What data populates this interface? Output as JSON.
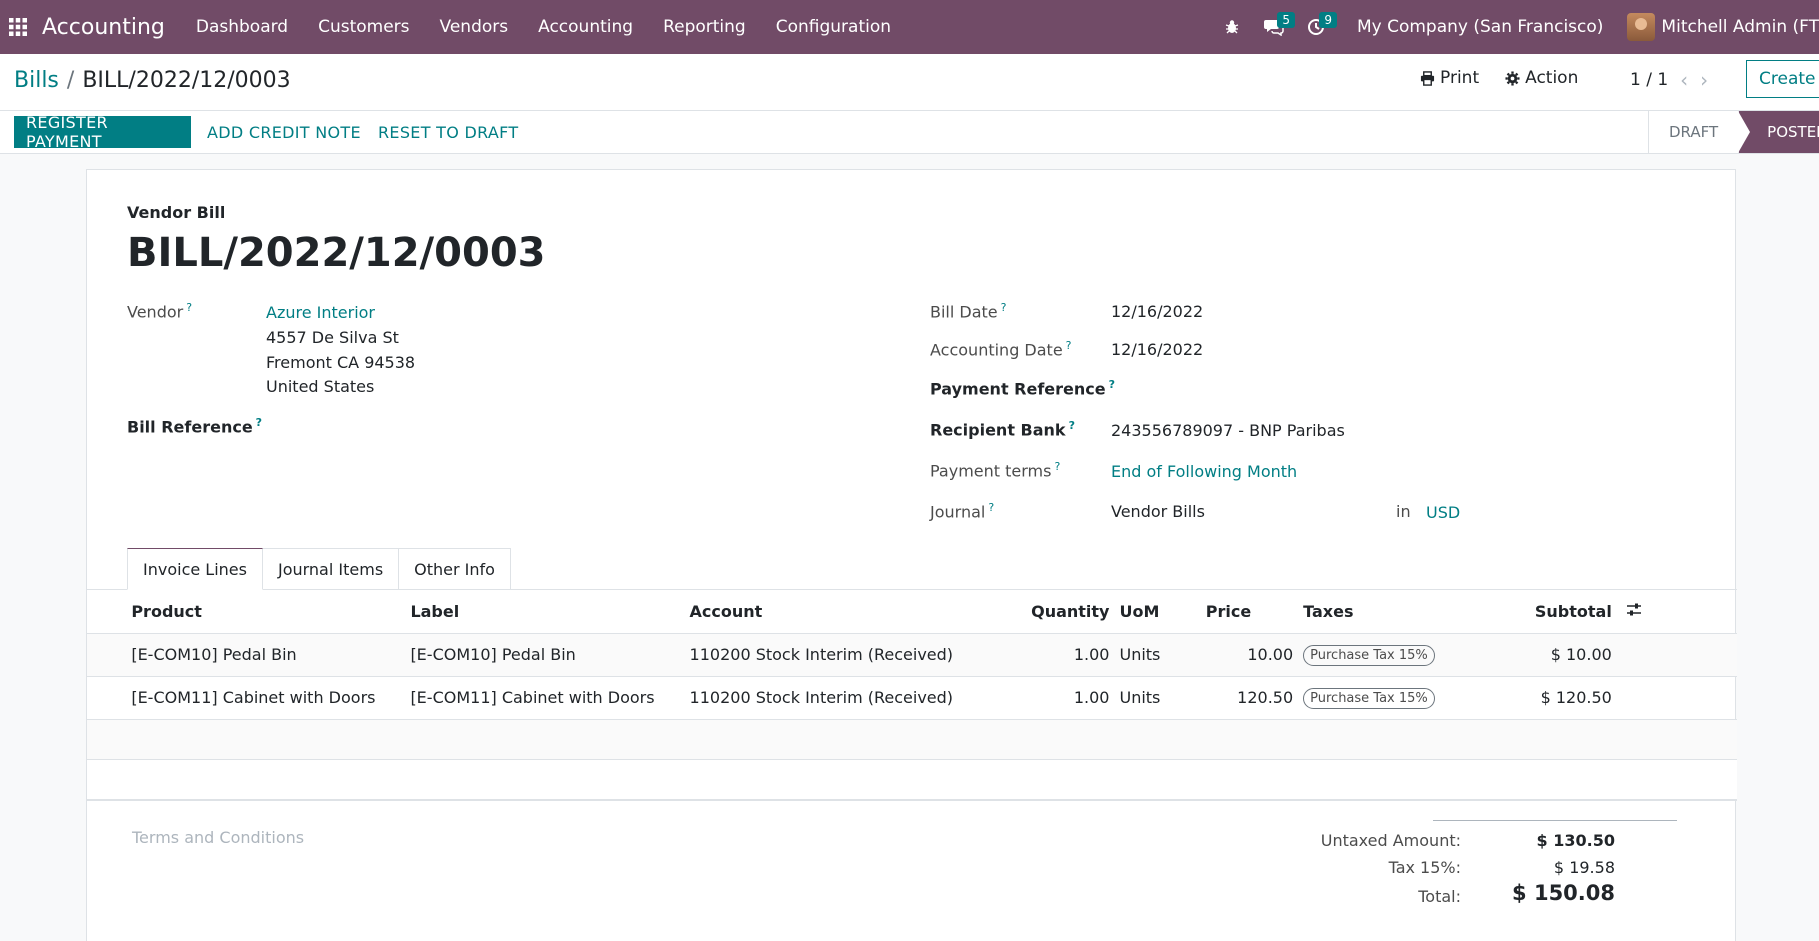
{
  "navbar": {
    "app_name": "Accounting",
    "menu": [
      "Dashboard",
      "Customers",
      "Vendors",
      "Accounting",
      "Reporting",
      "Configuration"
    ],
    "messages_count": "5",
    "activities_count": "9",
    "company": "My Company (San Francisco)",
    "user": "Mitchell Admin (FT"
  },
  "control_panel": {
    "breadcrumb_parent": "Bills",
    "breadcrumb_separator": "/",
    "breadcrumb_current": "BILL/2022/12/0003",
    "print_label": "Print",
    "action_label": "Action",
    "pager": "1 / 1",
    "create_label": "Create"
  },
  "statusbar": {
    "register_payment": "REGISTER PAYMENT",
    "add_credit_note": "ADD CREDIT NOTE",
    "reset_to_draft": "RESET TO DRAFT",
    "stages": [
      "DRAFT",
      "POSTED"
    ],
    "active_stage": "POSTED"
  },
  "form": {
    "doc_type": "Vendor Bill",
    "doc_name": "BILL/2022/12/0003",
    "vendor_label": "Vendor",
    "vendor_name": "Azure Interior",
    "vendor_address": [
      "4557 De Silva St",
      "Fremont CA 94538",
      "United States"
    ],
    "bill_reference_label": "Bill Reference",
    "bill_date_label": "Bill Date",
    "bill_date": "12/16/2022",
    "accounting_date_label": "Accounting Date",
    "accounting_date": "12/16/2022",
    "payment_reference_label": "Payment Reference",
    "recipient_bank_label": "Recipient Bank",
    "recipient_bank": "243556789097 - BNP Paribas",
    "payment_terms_label": "Payment terms",
    "payment_terms": "End of Following Month",
    "journal_label": "Journal",
    "journal": "Vendor Bills",
    "currency_in": "in",
    "currency": "USD",
    "help_mark": "?"
  },
  "tabs": [
    "Invoice Lines",
    "Journal Items",
    "Other Info"
  ],
  "lines": {
    "headers": [
      "Product",
      "Label",
      "Account",
      "Quantity",
      "UoM",
      "Price",
      "Taxes",
      "Subtotal"
    ],
    "rows": [
      {
        "product": "[E-COM10] Pedal Bin",
        "label": "[E-COM10] Pedal Bin",
        "account": "110200 Stock Interim (Received)",
        "quantity": "1.00",
        "uom": "Units",
        "price": "10.00",
        "tax": "Purchase Tax 15%",
        "subtotal": "$ 10.00"
      },
      {
        "product": "[E-COM11] Cabinet with Doors",
        "label": "[E-COM11] Cabinet with Doors",
        "account": "110200 Stock Interim (Received)",
        "quantity": "1.00",
        "uom": "Units",
        "price": "120.50",
        "tax": "Purchase Tax 15%",
        "subtotal": "$ 120.50"
      }
    ]
  },
  "footer": {
    "terms_placeholder": "Terms and Conditions",
    "untaxed_label": "Untaxed Amount:",
    "untaxed_value": "$ 130.50",
    "tax_label": "Tax 15%:",
    "tax_value": "$ 19.58",
    "total_label": "Total:",
    "total_value": "$ 150.08"
  },
  "colors": {
    "brand": "#714b67",
    "primary": "#017e84"
  }
}
